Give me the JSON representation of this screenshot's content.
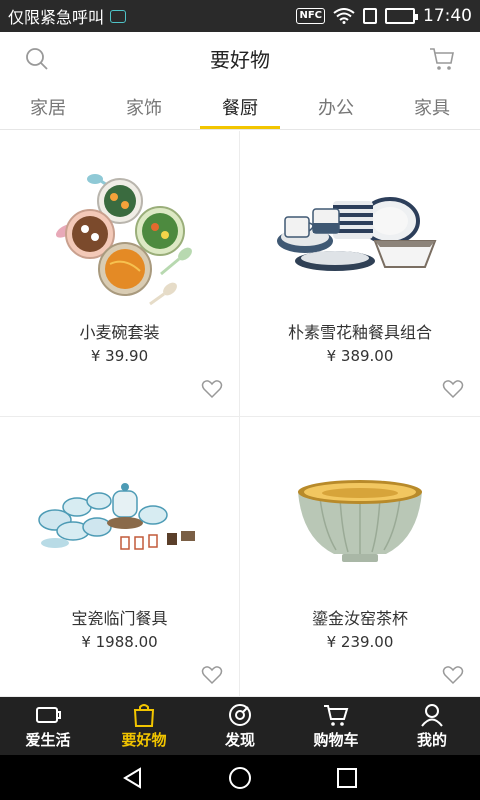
{
  "status_bar": {
    "carrier": "仅限紧急呼叫",
    "nfc": "NFC",
    "time": "17:40"
  },
  "header": {
    "title": "要好物"
  },
  "tabs": [
    {
      "label": "家居",
      "active": false
    },
    {
      "label": "家饰",
      "active": false
    },
    {
      "label": "餐厨",
      "active": true
    },
    {
      "label": "办公",
      "active": false
    },
    {
      "label": "家具",
      "active": false
    }
  ],
  "products": [
    {
      "name": "小麦碗套装",
      "price": "¥ 39.90"
    },
    {
      "name": "朴素雪花釉餐具组合",
      "price": "¥ 389.00"
    },
    {
      "name": "宝瓷临门餐具",
      "price": "¥ 1988.00"
    },
    {
      "name": "鎏金汝窑茶杯",
      "price": "¥ 239.00"
    }
  ],
  "bottom_nav": [
    {
      "label": "爱生活",
      "icon": "cup-icon",
      "active": false
    },
    {
      "label": "要好物",
      "icon": "shopping-bag-icon",
      "active": true
    },
    {
      "label": "发现",
      "icon": "compass-icon",
      "active": false
    },
    {
      "label": "购物车",
      "icon": "cart-icon",
      "active": false
    },
    {
      "label": "我的",
      "icon": "user-icon",
      "active": false
    }
  ],
  "colors": {
    "accent": "#f2c500",
    "nav_bg": "#222222",
    "status_bg": "#2a2a2a"
  }
}
